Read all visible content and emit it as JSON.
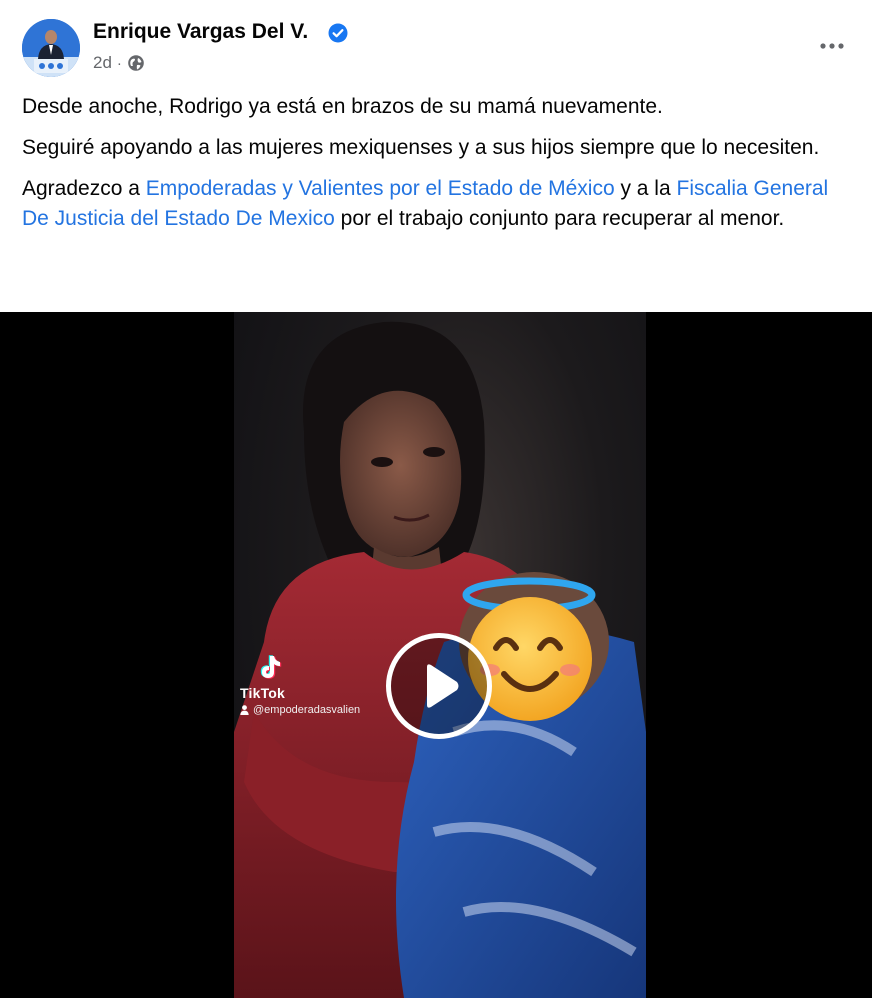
{
  "post": {
    "author": "Enrique Vargas Del V.",
    "time": "2d",
    "separator": "·",
    "audience_icon": "globe-icon",
    "verified_icon": "verified-badge-icon",
    "more_icon": "more-options-icon",
    "paragraphs": {
      "p1": "Desde anoche, Rodrigo ya está en brazos de su mamá nuevamente.",
      "p2": "Seguiré apoyando a las mujeres mexiquenses y a sus hijos siempre que lo necesiten.",
      "p3_a": "Agradezco a ",
      "p3_link1": "Empoderadas y Valientes por el Estado de México",
      "p3_b": " y a la ",
      "p3_link2": "Fiscalia General De Justicia del Estado De Mexico",
      "p3_c": " por el trabajo conjunto para recuperar al menor."
    }
  },
  "video": {
    "watermark_brand": "TikTok",
    "watermark_handle": "@empoderadasvalien",
    "play_icon": "play-icon",
    "emoji_overlay": "smiling-face-with-halo"
  },
  "colors": {
    "link": "#2374e1",
    "verified": "#1877f2",
    "secondary_text": "#65676b",
    "video_bg": "#000000"
  }
}
